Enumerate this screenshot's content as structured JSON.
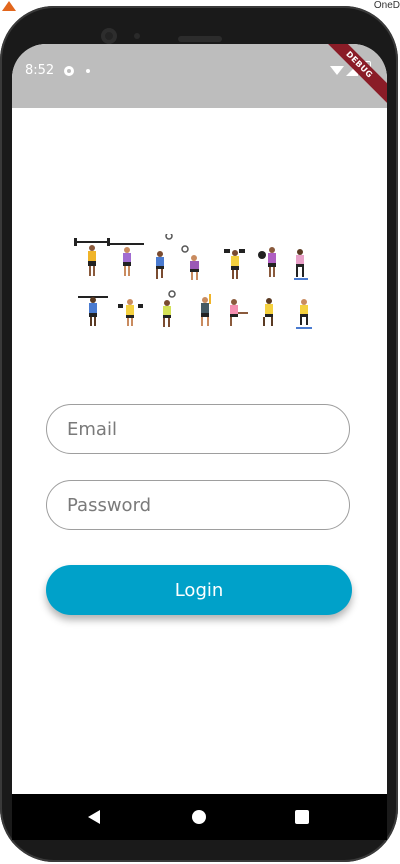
{
  "status_bar": {
    "time": "8:52"
  },
  "debug_banner": "DEBUG",
  "login_form": {
    "email_placeholder": "Email",
    "password_placeholder": "Password",
    "login_label": "Login"
  },
  "desktop": {
    "corner_text": "OneD"
  },
  "colors": {
    "primary": "#00a1c9",
    "status_bar_bg": "#bdbdbd",
    "debug_ribbon": "#8a1c27"
  },
  "icons": {
    "status": [
      "gear-icon",
      "wifi-icon",
      "signal-icon",
      "battery-icon"
    ],
    "nav": [
      "back-icon",
      "home-icon",
      "recents-icon"
    ]
  }
}
